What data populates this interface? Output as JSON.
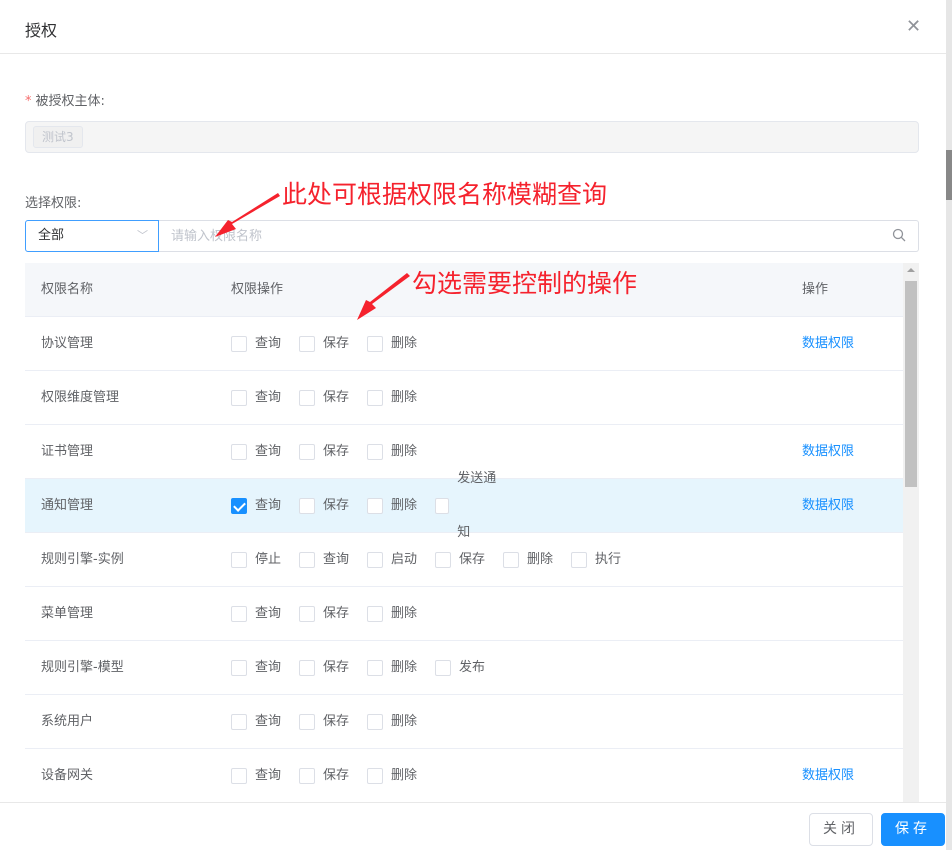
{
  "dialog": {
    "title": "授权",
    "close_icon": "close-icon"
  },
  "subject": {
    "label": "被授权主体:",
    "required_mark": "*",
    "tag": "测试3"
  },
  "permission": {
    "label": "选择权限:",
    "select_value": "全部",
    "search_placeholder": "请输入权限名称"
  },
  "table": {
    "headers": {
      "name": "权限名称",
      "ops": "权限操作",
      "action": "操作"
    },
    "rows": [
      {
        "name": "协议管理",
        "ops": [
          {
            "label": "查询",
            "checked": false
          },
          {
            "label": "保存",
            "checked": false
          },
          {
            "label": "删除",
            "checked": false
          }
        ],
        "action": "数据权限"
      },
      {
        "name": "权限维度管理",
        "ops": [
          {
            "label": "查询",
            "checked": false
          },
          {
            "label": "保存",
            "checked": false
          },
          {
            "label": "删除",
            "checked": false
          }
        ],
        "action": ""
      },
      {
        "name": "证书管理",
        "ops": [
          {
            "label": "查询",
            "checked": false
          },
          {
            "label": "保存",
            "checked": false
          },
          {
            "label": "删除",
            "checked": false
          }
        ],
        "action": "数据权限"
      },
      {
        "name": "通知管理",
        "ops": [
          {
            "label": "查询",
            "checked": true
          },
          {
            "label": "保存",
            "checked": false
          },
          {
            "label": "删除",
            "checked": false
          },
          {
            "label": "发送通知",
            "checked": false
          }
        ],
        "action": "数据权限",
        "highlighted": true
      },
      {
        "name": "规则引擎-实例",
        "ops": [
          {
            "label": "停止",
            "checked": false
          },
          {
            "label": "查询",
            "checked": false
          },
          {
            "label": "启动",
            "checked": false
          },
          {
            "label": "保存",
            "checked": false
          },
          {
            "label": "删除",
            "checked": false
          },
          {
            "label": "执行",
            "checked": false
          }
        ],
        "action": ""
      },
      {
        "name": "菜单管理",
        "ops": [
          {
            "label": "查询",
            "checked": false
          },
          {
            "label": "保存",
            "checked": false
          },
          {
            "label": "删除",
            "checked": false
          }
        ],
        "action": ""
      },
      {
        "name": "规则引擎-模型",
        "ops": [
          {
            "label": "查询",
            "checked": false
          },
          {
            "label": "保存",
            "checked": false
          },
          {
            "label": "删除",
            "checked": false
          },
          {
            "label": "发布",
            "checked": false
          }
        ],
        "action": ""
      },
      {
        "name": "系统用户",
        "ops": [
          {
            "label": "查询",
            "checked": false
          },
          {
            "label": "保存",
            "checked": false
          },
          {
            "label": "删除",
            "checked": false
          }
        ],
        "action": ""
      },
      {
        "name": "设备网关",
        "ops": [
          {
            "label": "查询",
            "checked": false
          },
          {
            "label": "保存",
            "checked": false
          },
          {
            "label": "删除",
            "checked": false
          }
        ],
        "action": "数据权限"
      }
    ]
  },
  "annotations": {
    "search_hint": "此处可根据权限名称模糊查询",
    "check_hint": "勾选需要控制的操作"
  },
  "footer": {
    "close": "关闭",
    "save": "保存"
  },
  "colors": {
    "primary": "#1890ff",
    "annotation": "#f5222d",
    "highlight_row": "#e6f5fd"
  }
}
